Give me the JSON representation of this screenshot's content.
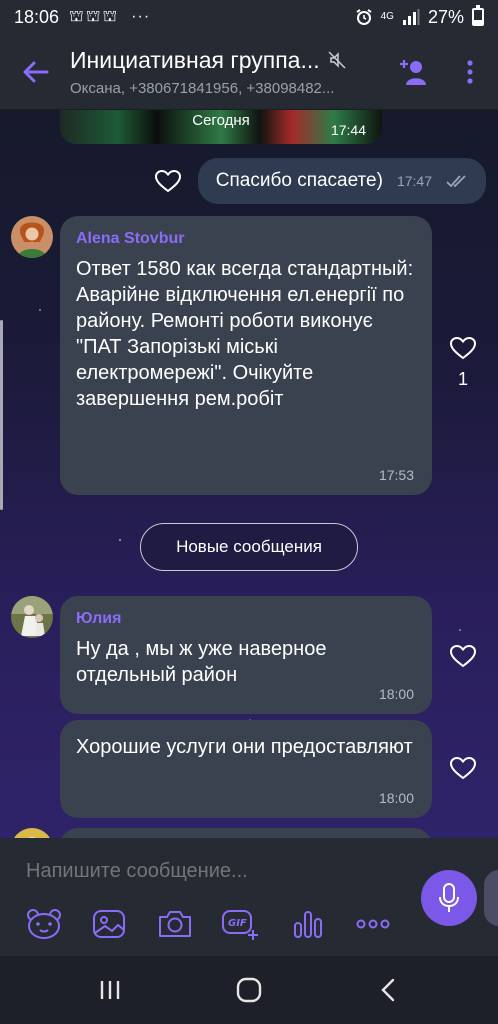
{
  "status_bar": {
    "time": "18:06",
    "notif_icons": "⛫⛫⛫",
    "more": "···",
    "network": "4G",
    "battery": "27%"
  },
  "header": {
    "title": "Инициативная группа...",
    "subtitle": "Оксана, +380671841956, +38098482...",
    "muted": true
  },
  "chat": {
    "image_message": {
      "date_label": "Сегодня",
      "time": "17:44"
    },
    "outgoing": {
      "text": "Спасибо  спасаете)",
      "time": "17:47",
      "status": "read"
    },
    "messages": [
      {
        "sender": "Alena Stovbur",
        "text": "Ответ 1580 как всегда стандартный:\nАварійне відключення ел.енергії  по району. Ремонті роботи виконує \"ПАТ Запорізькі міські електромережі\". Очікуйте завершення рем.робіт",
        "time": "17:53",
        "likes": "1"
      },
      {
        "sender": "Юлия",
        "text": "Ну да , мы ж уже наверное отдельный район",
        "time": "18:00",
        "likes": ""
      },
      {
        "sender": "",
        "text": "Хорошие услуги они предоставляют",
        "time": "18:00",
        "likes": ""
      }
    ],
    "new_messages_label": "Новые сообщения"
  },
  "composer": {
    "placeholder": "Напишите сообщение..."
  },
  "colors": {
    "accent": "#7b58e8",
    "sender_name": "#8b6cf7",
    "bubble_in": "#3a414f",
    "bubble_out": "#2e3b50"
  }
}
